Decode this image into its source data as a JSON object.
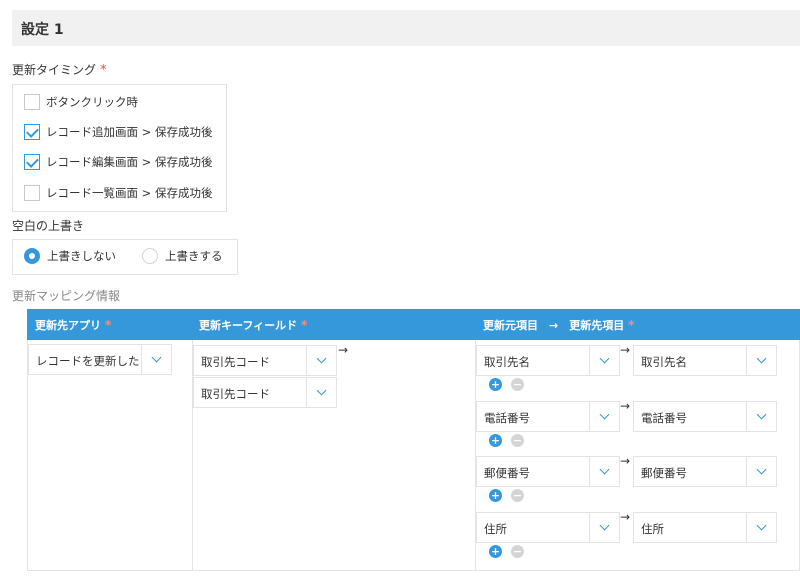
{
  "section": {
    "title": "設定 1"
  },
  "timing": {
    "label": "更新タイミング",
    "required_mark": "*",
    "options": [
      {
        "label": "ボタンクリック時",
        "checked": false
      },
      {
        "label": "レコード追加画面 > 保存成功後",
        "checked": true
      },
      {
        "label": "レコード編集画面 > 保存成功後",
        "checked": true
      },
      {
        "label": "レコード一覧画面 > 保存成功後",
        "checked": false
      }
    ]
  },
  "blank_overwrite": {
    "label": "空白の上書き",
    "options": [
      {
        "label": "上書きしない",
        "selected": true
      },
      {
        "label": "上書きする",
        "selected": false
      }
    ]
  },
  "mapping": {
    "label": "更新マッピング情報",
    "headers": {
      "target_app": "更新先アプリ",
      "key_field": "更新キーフィールド",
      "source_to_target": "更新元項目　→　更新先項目",
      "required_mark": "*"
    },
    "target_app_value": "レコードを更新したい",
    "key_fields": [
      "取引先コード",
      "取引先コード"
    ],
    "field_pairs": [
      {
        "source": "取引先名",
        "target": "取引先名"
      },
      {
        "source": "電話番号",
        "target": "電話番号"
      },
      {
        "source": "郵便番号",
        "target": "郵便番号"
      },
      {
        "source": "住所",
        "target": "住所"
      }
    ],
    "arrow": "→",
    "add_glyph": "+",
    "remove_glyph": "−"
  },
  "colors": {
    "accent": "#3498db",
    "required": "#e74c3c",
    "header_bg": "#f1f1f1"
  }
}
